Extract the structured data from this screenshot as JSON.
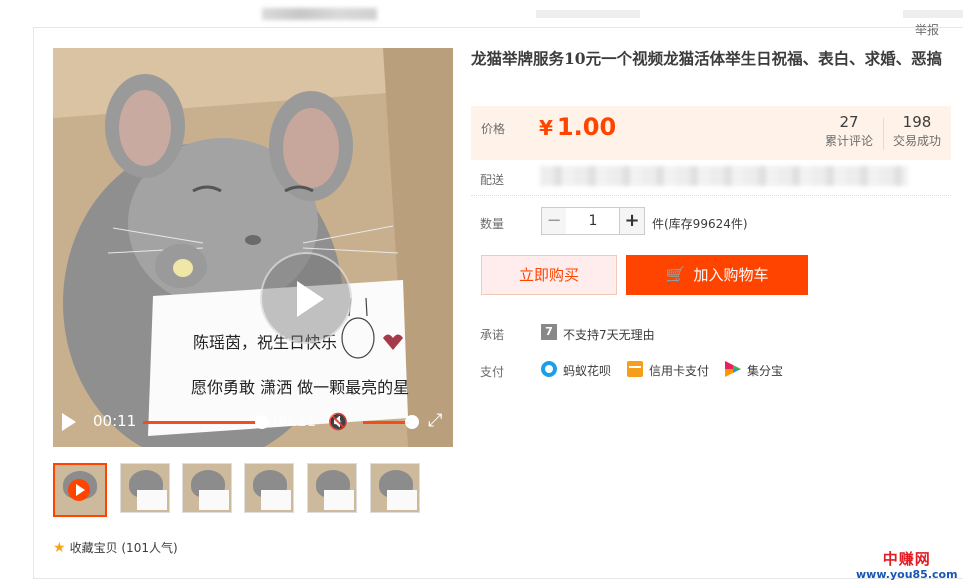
{
  "report_link": "举报",
  "video": {
    "current_time": "00:11",
    "duration": "00:11",
    "card_line1": "陈瑶茵，祝生日快乐",
    "card_line2": "愿你勇敢 潇洒 做一颗最亮的星"
  },
  "gallery": {
    "thumb_count": 6,
    "active_index": 0
  },
  "favorite": {
    "label": "收藏宝贝 (101人气)"
  },
  "product": {
    "title": "龙猫举牌服务10元一个视频龙猫活体举生日祝福、表白、求婚、恶搞"
  },
  "price": {
    "label": "价格",
    "symbol": "¥",
    "value": "1.00",
    "reviews_count": "27",
    "reviews_label": "累计评论",
    "sales_count": "198",
    "sales_label": "交易成功"
  },
  "delivery": {
    "label": "配送"
  },
  "quantity": {
    "label": "数量",
    "minus": "−",
    "value": "1",
    "plus": "+",
    "stock_text": "件(库存99624件)"
  },
  "actions": {
    "buy_now": "立即购买",
    "add_to_cart": "加入购物车"
  },
  "promise": {
    "label": "承诺",
    "icon_glyph": "7",
    "text": "不支持7天无理由"
  },
  "payment": {
    "label": "支付",
    "methods": [
      "蚂蚁花呗",
      "信用卡支付",
      "集分宝"
    ]
  },
  "watermark": {
    "line1": "中赚网",
    "line2": "www.you85.com"
  },
  "colors": {
    "accent": "#ff4400",
    "price_bg": "#fff2e8"
  }
}
